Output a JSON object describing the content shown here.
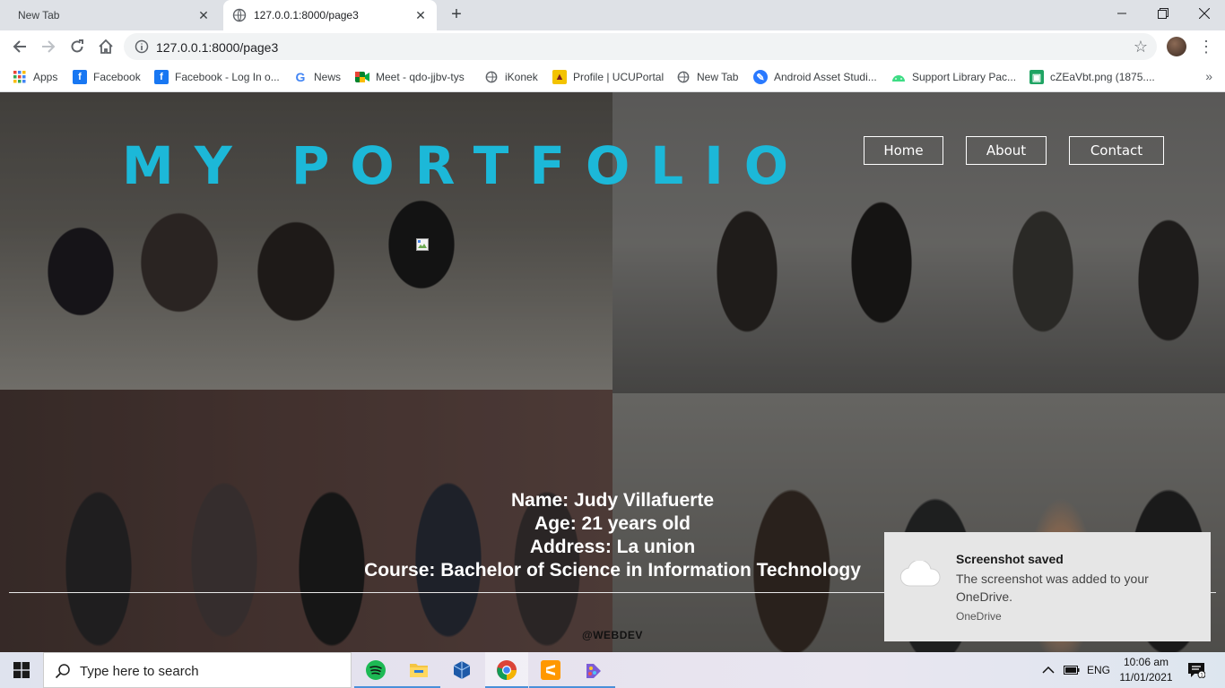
{
  "browser": {
    "tabs": [
      {
        "title": "New Tab",
        "active": false
      },
      {
        "title": "127.0.0.1:8000/page3",
        "active": true
      }
    ],
    "url": "127.0.0.1:8000/page3",
    "bookmarks": [
      {
        "label": "Apps",
        "icon": "apps-grid-icon"
      },
      {
        "label": "Facebook",
        "icon": "facebook-icon"
      },
      {
        "label": "Facebook - Log In o...",
        "icon": "facebook-icon"
      },
      {
        "label": "News",
        "icon": "google-icon"
      },
      {
        "label": "Meet - qdo-jjbv-tys",
        "icon": "meet-icon"
      },
      {
        "label": "iKonek",
        "icon": "globe-icon"
      },
      {
        "label": "Profile | UCUPortal",
        "icon": "portal-icon"
      },
      {
        "label": "New Tab",
        "icon": "globe-icon"
      },
      {
        "label": "Android Asset Studi...",
        "icon": "android-studio-icon"
      },
      {
        "label": "Support Library Pac...",
        "icon": "android-icon"
      },
      {
        "label": "cZEaVbt.png (1875....",
        "icon": "image-icon"
      }
    ]
  },
  "page": {
    "title": "MY PORTFOLIO",
    "nav": [
      "Home",
      "About",
      "Contact"
    ],
    "info": {
      "name": "Name: Judy Villafuerte",
      "age": "Age: 21 years old",
      "address": "Address: La union",
      "course": "Course: Bachelor of Science in Information Technology"
    },
    "footer": "@WEBDEV"
  },
  "toast": {
    "title": "Screenshot saved",
    "body": "The screenshot was added to your OneDrive.",
    "source": "OneDrive"
  },
  "taskbar": {
    "search_placeholder": "Type here to search",
    "apps": [
      "spotify-icon",
      "file-explorer-icon",
      "virtualbox-icon",
      "chrome-icon",
      "sublime-text-icon",
      "paint-tool-icon"
    ],
    "language": "ENG",
    "time": "10:06 am",
    "date": "11/01/2021"
  },
  "colors": {
    "title_accent": "#1cb8d8",
    "tab_strip": "#dee1e6"
  }
}
